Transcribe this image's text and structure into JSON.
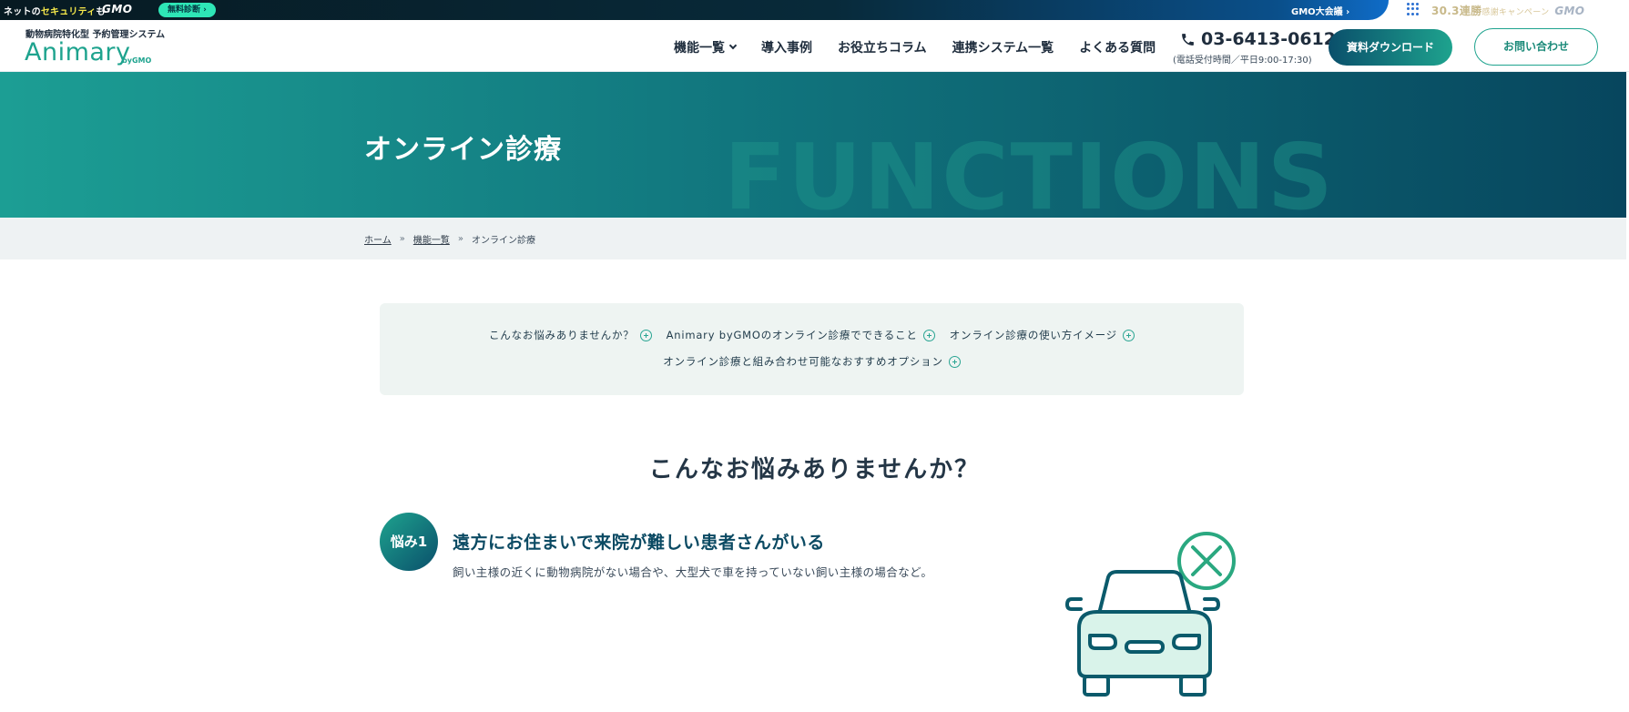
{
  "promo": {
    "tag_prefix": "ネットの",
    "tag_highlight": "セキュリティ",
    "tag_suffix": "も",
    "brand": "GMO",
    "pill": "無料診断 ›",
    "conference": "GMO大会議 ›",
    "campaign_num": "30.",
    "campaign_main": "3連勝",
    "campaign_sub": "感謝キャンペーン",
    "campaign_brand": "GMO"
  },
  "header": {
    "logo_sub": "動物病院特化型 予約管理システム",
    "logo_main": "Animary",
    "logo_by": "byGMO",
    "nav": [
      {
        "label": "機能一覧"
      },
      {
        "label": "導入事例"
      },
      {
        "label": "お役立ちコラム"
      },
      {
        "label": "連携システム一覧"
      },
      {
        "label": "よくある質問"
      }
    ],
    "tel": "03-6413-0612",
    "tel_hours": "(電話受付時間／平日9:00-17:30)",
    "download_label": "資料ダウンロード",
    "contact_label": "お問い合わせ"
  },
  "hero": {
    "bg_text": "FUNCTIONS",
    "title": "オンライン診療"
  },
  "breadcrumb": {
    "items": [
      "ホーム",
      "機能一覧",
      "オンライン診療"
    ],
    "sep": "»"
  },
  "toc": {
    "links": [
      "こんなお悩みありませんか？",
      "Animary byGMOのオンライン診療でできること",
      "オンライン診療の使い方イメージ",
      "オンライン診療と組み合わせ可能なおすすめオプション"
    ]
  },
  "section": {
    "title": "こんなお悩みありませんか？",
    "worry": {
      "badge": "悩み1",
      "title": "遠方にお住まいで来院が難しい患者さんがいる",
      "desc": "飼い主様の近くに動物病院がない場合や、大型犬で車を持っていない飼い主様の場合など。"
    }
  },
  "colors": {
    "accent": "#1ea38e",
    "dark": "#0a4f6b"
  }
}
